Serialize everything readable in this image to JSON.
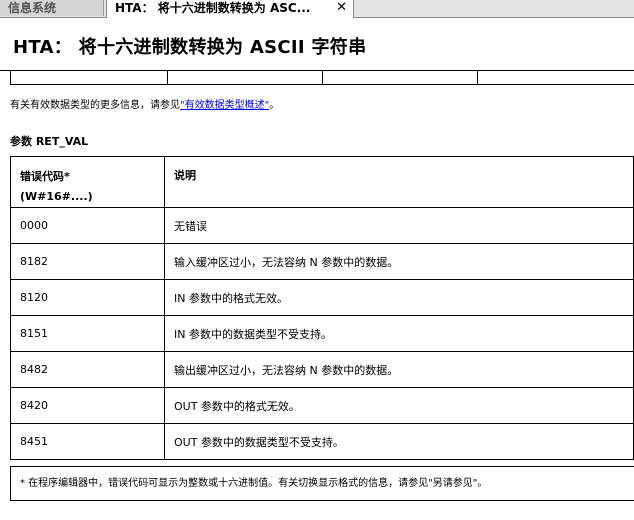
{
  "tabs": [
    {
      "label": "信息系统"
    },
    {
      "label": "HTA： 将十六进制数转换为 ASC..."
    }
  ],
  "tab_close_glyph": "✕",
  "page": {
    "title": "HTA： 将十六进制数转换为 ASCII 字符串",
    "info_prefix": "有关有效数据类型的更多信息，请参见",
    "info_link": "\"有效数据类型概述\"",
    "info_suffix": "。",
    "param_heading": "参数 RET_VAL"
  },
  "table": {
    "header_code_line1": "错误代码*",
    "header_code_line2": "(W#16#....)",
    "header_desc": "说明",
    "rows": [
      {
        "code": "0000",
        "desc": "无错误"
      },
      {
        "code": "8182",
        "desc": "输入缓冲区过小，无法容纳 N 参数中的数据。"
      },
      {
        "code": "8120",
        "desc": "IN 参数中的格式无效。"
      },
      {
        "code": "8151",
        "desc": "IN 参数中的数据类型不受支持。"
      },
      {
        "code": "8482",
        "desc": "输出缓冲区过小，无法容纳 N 参数中的数据。"
      },
      {
        "code": "8420",
        "desc": "OUT 参数中的格式无效。"
      },
      {
        "code": "8451",
        "desc": "OUT 参数中的数据类型不受支持。"
      }
    ],
    "footnote": "* 在程序编辑器中，错误代码可显示为整数或十六进制值。有关切换显示格式的信息，请参见\"另请参见\"。"
  }
}
